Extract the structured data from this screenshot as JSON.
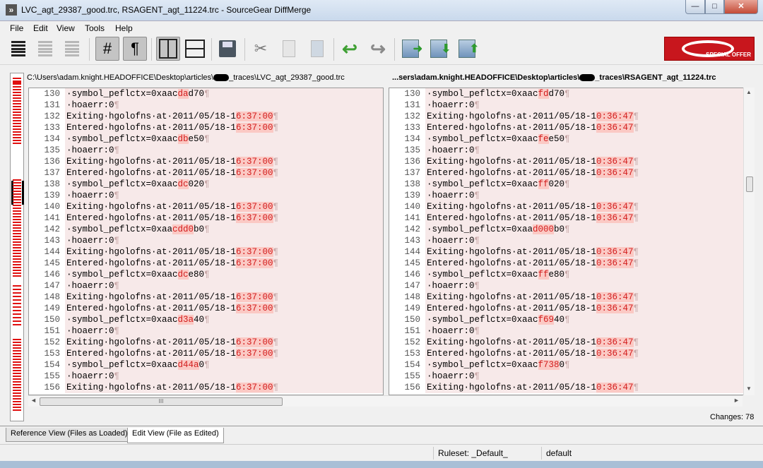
{
  "window": {
    "title": "LVC_agt_29387_good.trc, RSAGENT_agt_11224.trc - SourceGear DiffMerge",
    "minimize": "—",
    "maximize": "□",
    "close": "✕"
  },
  "menu": [
    "File",
    "Edit",
    "View",
    "Tools",
    "Help"
  ],
  "toolbar": {
    "icons": [
      "all-lines-icon",
      "changes-only-icon",
      "changes-context-icon",
      "line-numbers-icon",
      "pilcrow-icon",
      "side-by-side-icon",
      "stacked-icon",
      "save-icon",
      "cut-icon",
      "copy-icon",
      "paste-icon",
      "undo-icon",
      "redo-icon",
      "next-change-icon",
      "next-change-down-icon",
      "prev-change-up-icon"
    ],
    "line_numbers_glyph": "#",
    "pilcrow_glyph": "¶",
    "cut_glyph": "✂",
    "undo_glyph": "↩",
    "redo_glyph": "↪",
    "logo_text": "SPECIAL OFFER"
  },
  "colors": {
    "changed_background": "#f7e9e9",
    "highlight_background": "#fbc9c4",
    "highlight_text": "#d21c1c"
  },
  "left_path": {
    "before": "C:\\Users\\adam.knight.HEADOFFICE\\Desktop\\articles\\",
    "after": "_traces\\LVC_agt_29387_good.trc"
  },
  "right_path": {
    "before": "...sers\\adam.knight.HEADOFFICE\\Desktop\\articles\\",
    "after": "_traces\\RSAGENT_agt_11224.trc"
  },
  "pilcrow": "¶",
  "left_lines": [
    {
      "n": "130",
      "parts": [
        [
          "·symbol_peflctx=0xaac",
          ""
        ],
        [
          "da",
          "h"
        ],
        [
          "d70",
          ""
        ]
      ]
    },
    {
      "n": "131",
      "parts": [
        [
          "·hoaerr:0",
          ""
        ]
      ]
    },
    {
      "n": "132",
      "parts": [
        [
          "Exiting·hgolofns·at·2011/05/18-1",
          ""
        ],
        [
          "6:37:00",
          "h"
        ]
      ]
    },
    {
      "n": "133",
      "parts": [
        [
          "Entered·hgolofns·at·2011/05/18-1",
          ""
        ],
        [
          "6:37:00",
          "h"
        ]
      ]
    },
    {
      "n": "134",
      "parts": [
        [
          "·symbol_peflctx=0xaac",
          ""
        ],
        [
          "db",
          "h"
        ],
        [
          "e50",
          ""
        ]
      ]
    },
    {
      "n": "135",
      "parts": [
        [
          "·hoaerr:0",
          ""
        ]
      ]
    },
    {
      "n": "136",
      "parts": [
        [
          "Exiting·hgolofns·at·2011/05/18-1",
          ""
        ],
        [
          "6:37:00",
          "h"
        ]
      ]
    },
    {
      "n": "137",
      "parts": [
        [
          "Entered·hgolofns·at·2011/05/18-1",
          ""
        ],
        [
          "6:37:00",
          "h"
        ]
      ]
    },
    {
      "n": "138",
      "parts": [
        [
          "·symbol_peflctx=0xaac",
          ""
        ],
        [
          "dc",
          "h"
        ],
        [
          "020",
          ""
        ]
      ]
    },
    {
      "n": "139",
      "parts": [
        [
          "·hoaerr:0",
          ""
        ]
      ]
    },
    {
      "n": "140",
      "parts": [
        [
          "Exiting·hgolofns·at·2011/05/18-1",
          ""
        ],
        [
          "6:37:00",
          "h"
        ]
      ]
    },
    {
      "n": "141",
      "parts": [
        [
          "Entered·hgolofns·at·2011/05/18-1",
          ""
        ],
        [
          "6:37:00",
          "h"
        ]
      ]
    },
    {
      "n": "142",
      "parts": [
        [
          "·symbol_peflctx=0xaa",
          ""
        ],
        [
          "cdd0",
          "h"
        ],
        [
          "b0",
          ""
        ]
      ]
    },
    {
      "n": "143",
      "parts": [
        [
          "·hoaerr:0",
          ""
        ]
      ]
    },
    {
      "n": "144",
      "parts": [
        [
          "Exiting·hgolofns·at·2011/05/18-1",
          ""
        ],
        [
          "6:37:00",
          "h"
        ]
      ]
    },
    {
      "n": "145",
      "parts": [
        [
          "Entered·hgolofns·at·2011/05/18-1",
          ""
        ],
        [
          "6:37:00",
          "h"
        ]
      ]
    },
    {
      "n": "146",
      "parts": [
        [
          "·symbol_peflctx=0xaac",
          ""
        ],
        [
          "dc",
          "h"
        ],
        [
          "e80",
          ""
        ]
      ]
    },
    {
      "n": "147",
      "parts": [
        [
          "·hoaerr:0",
          ""
        ]
      ]
    },
    {
      "n": "148",
      "parts": [
        [
          "Exiting·hgolofns·at·2011/05/18-1",
          ""
        ],
        [
          "6:37:00",
          "h"
        ]
      ]
    },
    {
      "n": "149",
      "parts": [
        [
          "Entered·hgolofns·at·2011/05/18-1",
          ""
        ],
        [
          "6:37:00",
          "h"
        ]
      ]
    },
    {
      "n": "150",
      "parts": [
        [
          "·symbol_peflctx=0xaac",
          ""
        ],
        [
          "d3a",
          "h"
        ],
        [
          "40",
          ""
        ]
      ]
    },
    {
      "n": "151",
      "parts": [
        [
          "·hoaerr:0",
          ""
        ]
      ]
    },
    {
      "n": "152",
      "parts": [
        [
          "Exiting·hgolofns·at·2011/05/18-1",
          ""
        ],
        [
          "6:37:00",
          "h"
        ]
      ]
    },
    {
      "n": "153",
      "parts": [
        [
          "Entered·hgolofns·at·2011/05/18-1",
          ""
        ],
        [
          "6:37:00",
          "h"
        ]
      ]
    },
    {
      "n": "154",
      "parts": [
        [
          "·symbol_peflctx=0xaac",
          ""
        ],
        [
          "d44a",
          "h"
        ],
        [
          "0",
          ""
        ]
      ]
    },
    {
      "n": "155",
      "parts": [
        [
          "·hoaerr:0",
          ""
        ]
      ]
    },
    {
      "n": "156",
      "parts": [
        [
          "Exiting·hgolofns·at·2011/05/18-1",
          ""
        ],
        [
          "6:37:00",
          "h"
        ]
      ]
    }
  ],
  "right_lines": [
    {
      "n": "130",
      "parts": [
        [
          "·symbol_peflctx=0xaac",
          ""
        ],
        [
          "fd",
          "h"
        ],
        [
          "d70",
          ""
        ]
      ]
    },
    {
      "n": "131",
      "parts": [
        [
          "·hoaerr:0",
          ""
        ]
      ]
    },
    {
      "n": "132",
      "parts": [
        [
          "Exiting·hgolofns·at·2011/05/18-1",
          ""
        ],
        [
          "0:36:47",
          "h"
        ]
      ]
    },
    {
      "n": "133",
      "parts": [
        [
          "Entered·hgolofns·at·2011/05/18-1",
          ""
        ],
        [
          "0:36:47",
          "h"
        ]
      ]
    },
    {
      "n": "134",
      "parts": [
        [
          "·symbol_peflctx=0xaac",
          ""
        ],
        [
          "fe",
          "h"
        ],
        [
          "e50",
          ""
        ]
      ]
    },
    {
      "n": "135",
      "parts": [
        [
          "·hoaerr:0",
          ""
        ]
      ]
    },
    {
      "n": "136",
      "parts": [
        [
          "Exiting·hgolofns·at·2011/05/18-1",
          ""
        ],
        [
          "0:36:47",
          "h"
        ]
      ]
    },
    {
      "n": "137",
      "parts": [
        [
          "Entered·hgolofns·at·2011/05/18-1",
          ""
        ],
        [
          "0:36:47",
          "h"
        ]
      ]
    },
    {
      "n": "138",
      "parts": [
        [
          "·symbol_peflctx=0xaac",
          ""
        ],
        [
          "ff",
          "h"
        ],
        [
          "020",
          ""
        ]
      ]
    },
    {
      "n": "139",
      "parts": [
        [
          "·hoaerr:0",
          ""
        ]
      ]
    },
    {
      "n": "140",
      "parts": [
        [
          "Exiting·hgolofns·at·2011/05/18-1",
          ""
        ],
        [
          "0:36:47",
          "h"
        ]
      ]
    },
    {
      "n": "141",
      "parts": [
        [
          "Entered·hgolofns·at·2011/05/18-1",
          ""
        ],
        [
          "0:36:47",
          "h"
        ]
      ]
    },
    {
      "n": "142",
      "parts": [
        [
          "·symbol_peflctx=0xaa",
          ""
        ],
        [
          "d000",
          "h"
        ],
        [
          "b0",
          ""
        ]
      ]
    },
    {
      "n": "143",
      "parts": [
        [
          "·hoaerr:0",
          ""
        ]
      ]
    },
    {
      "n": "144",
      "parts": [
        [
          "Exiting·hgolofns·at·2011/05/18-1",
          ""
        ],
        [
          "0:36:47",
          "h"
        ]
      ]
    },
    {
      "n": "145",
      "parts": [
        [
          "Entered·hgolofns·at·2011/05/18-1",
          ""
        ],
        [
          "0:36:47",
          "h"
        ]
      ]
    },
    {
      "n": "146",
      "parts": [
        [
          "·symbol_peflctx=0xaac",
          ""
        ],
        [
          "ff",
          "h"
        ],
        [
          "e80",
          ""
        ]
      ]
    },
    {
      "n": "147",
      "parts": [
        [
          "·hoaerr:0",
          ""
        ]
      ]
    },
    {
      "n": "148",
      "parts": [
        [
          "Exiting·hgolofns·at·2011/05/18-1",
          ""
        ],
        [
          "0:36:47",
          "h"
        ]
      ]
    },
    {
      "n": "149",
      "parts": [
        [
          "Entered·hgolofns·at·2011/05/18-1",
          ""
        ],
        [
          "0:36:47",
          "h"
        ]
      ]
    },
    {
      "n": "150",
      "parts": [
        [
          "·symbol_peflctx=0xaac",
          ""
        ],
        [
          "f69",
          "h"
        ],
        [
          "40",
          ""
        ]
      ]
    },
    {
      "n": "151",
      "parts": [
        [
          "·hoaerr:0",
          ""
        ]
      ]
    },
    {
      "n": "152",
      "parts": [
        [
          "Exiting·hgolofns·at·2011/05/18-1",
          ""
        ],
        [
          "0:36:47",
          "h"
        ]
      ]
    },
    {
      "n": "153",
      "parts": [
        [
          "Entered·hgolofns·at·2011/05/18-1",
          ""
        ],
        [
          "0:36:47",
          "h"
        ]
      ]
    },
    {
      "n": "154",
      "parts": [
        [
          "·symbol_peflctx=0xaac",
          ""
        ],
        [
          "f738",
          "h"
        ],
        [
          "0",
          ""
        ]
      ]
    },
    {
      "n": "155",
      "parts": [
        [
          "·hoaerr:0",
          ""
        ]
      ]
    },
    {
      "n": "156",
      "parts": [
        [
          "Exiting·hgolofns·at·2011/05/18-1",
          ""
        ],
        [
          "0:36:47",
          "h"
        ]
      ]
    }
  ],
  "scrollbar": {
    "grip": "III",
    "left": "◄",
    "right": "►",
    "up": "▲",
    "down": "▼"
  },
  "changes_label": "Changes: 78",
  "tabs": [
    "Reference View (Files as Loaded)",
    "Edit View (File as Edited)"
  ],
  "status": {
    "ruleset": "Ruleset: _Default_",
    "default": "default"
  }
}
